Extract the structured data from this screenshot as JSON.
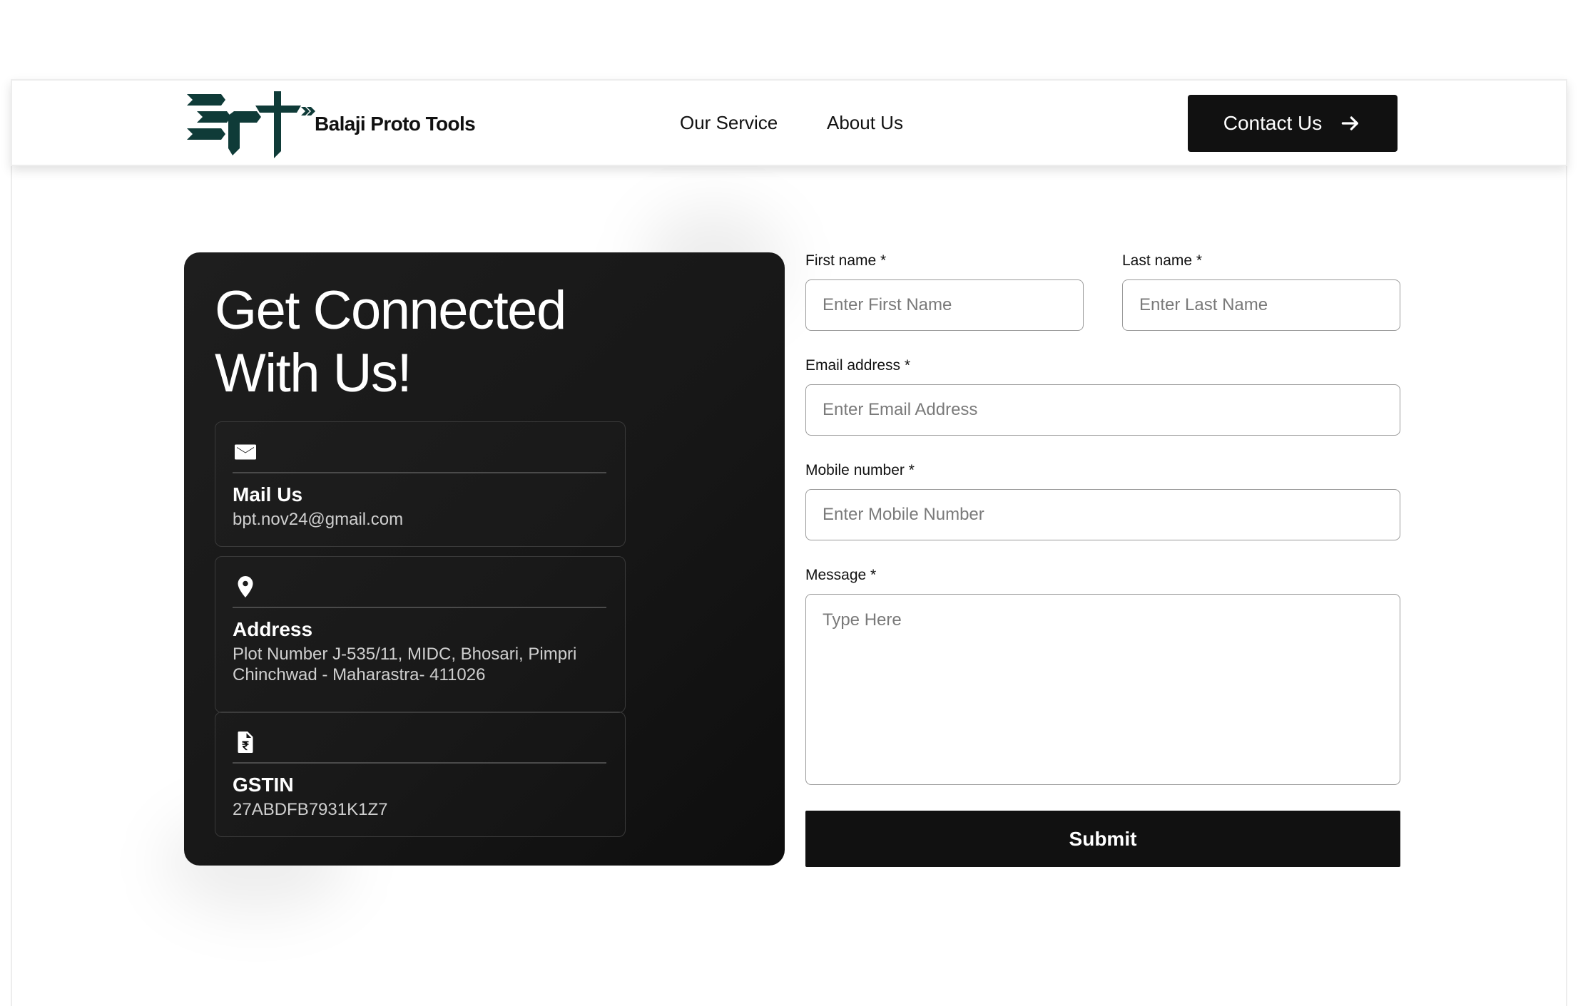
{
  "header": {
    "brand_name": "Balaji Proto Tools",
    "logo_color": "#0f3b38",
    "nav": [
      {
        "label": "Our Service"
      },
      {
        "label": "About Us"
      }
    ],
    "contact_button": "Contact Us"
  },
  "info_panel": {
    "title": "Get Connected\nWith Us!",
    "cards": [
      {
        "icon": "mail-icon",
        "title": "Mail Us",
        "text": "bpt.nov24@gmail.com"
      },
      {
        "icon": "location-pin-icon",
        "title": "Address",
        "text": "Plot Number J-535/11, MIDC, Bhosari, Pimpri Chinchwad - Maharastra- 411026"
      },
      {
        "icon": "document-rupee-icon",
        "title": "GSTIN",
        "text": "27ABDFB7931K1Z7"
      }
    ]
  },
  "form": {
    "first_name": {
      "label": "First name *",
      "placeholder": "Enter First Name",
      "value": ""
    },
    "last_name": {
      "label": "Last name *",
      "placeholder": "Enter Last Name",
      "value": ""
    },
    "email": {
      "label": "Email address *",
      "placeholder": "Enter Email Address",
      "value": ""
    },
    "mobile": {
      "label": "Mobile number *",
      "placeholder": "Enter Mobile Number",
      "value": ""
    },
    "message": {
      "label": "Message *",
      "placeholder": "Type Here",
      "value": ""
    },
    "submit_label": "Submit"
  },
  "colors": {
    "primary_dark": "#111111",
    "panel_bg": "#1a1a1a",
    "logo_teal": "#0f3b38"
  }
}
